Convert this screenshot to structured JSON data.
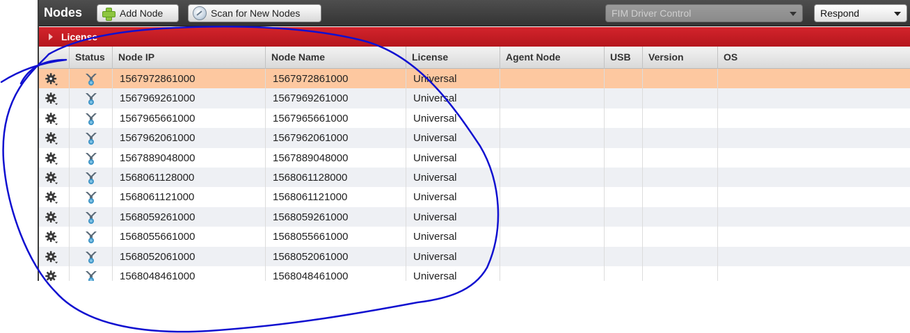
{
  "toolbar": {
    "title": "Nodes",
    "add_node_label": "Add Node",
    "scan_label": "Scan for New Nodes",
    "fim_select_value": "FIM Driver Control",
    "respond_select_value": "Respond"
  },
  "license_bar": {
    "label": "License"
  },
  "columns": [
    "Status",
    "Node IP",
    "Node Name",
    "License",
    "Agent Node",
    "USB",
    "Version",
    "OS"
  ],
  "rows": [
    {
      "ip": "1567972861000",
      "name": "1567972861000",
      "license": "Universal",
      "selected": true
    },
    {
      "ip": "1567969261000",
      "name": "1567969261000",
      "license": "Universal"
    },
    {
      "ip": "1567965661000",
      "name": "1567965661000",
      "license": "Universal"
    },
    {
      "ip": "1567962061000",
      "name": "1567962061000",
      "license": "Universal"
    },
    {
      "ip": "1567889048000",
      "name": "1567889048000",
      "license": "Universal"
    },
    {
      "ip": "1568061128000",
      "name": "1568061128000",
      "license": "Universal"
    },
    {
      "ip": "1568061121000",
      "name": "1568061121000",
      "license": "Universal"
    },
    {
      "ip": "1568059261000",
      "name": "1568059261000",
      "license": "Universal"
    },
    {
      "ip": "1568055661000",
      "name": "1568055661000",
      "license": "Universal"
    },
    {
      "ip": "1568052061000",
      "name": "1568052061000",
      "license": "Universal"
    },
    {
      "ip": "1568048461000",
      "name": "1568048461000",
      "license": "Universal"
    }
  ],
  "icons": {
    "add": "plus-icon",
    "scan": "scan-icon",
    "row_actions": "gear-icon",
    "status": "node-status-icon"
  },
  "colors": {
    "toolbar": "#3f3f3f",
    "license_bar": "#c41e25",
    "selected_row": "#fdc8a0",
    "alt_row": "#eef0f4",
    "annotation": "#1010d0"
  }
}
